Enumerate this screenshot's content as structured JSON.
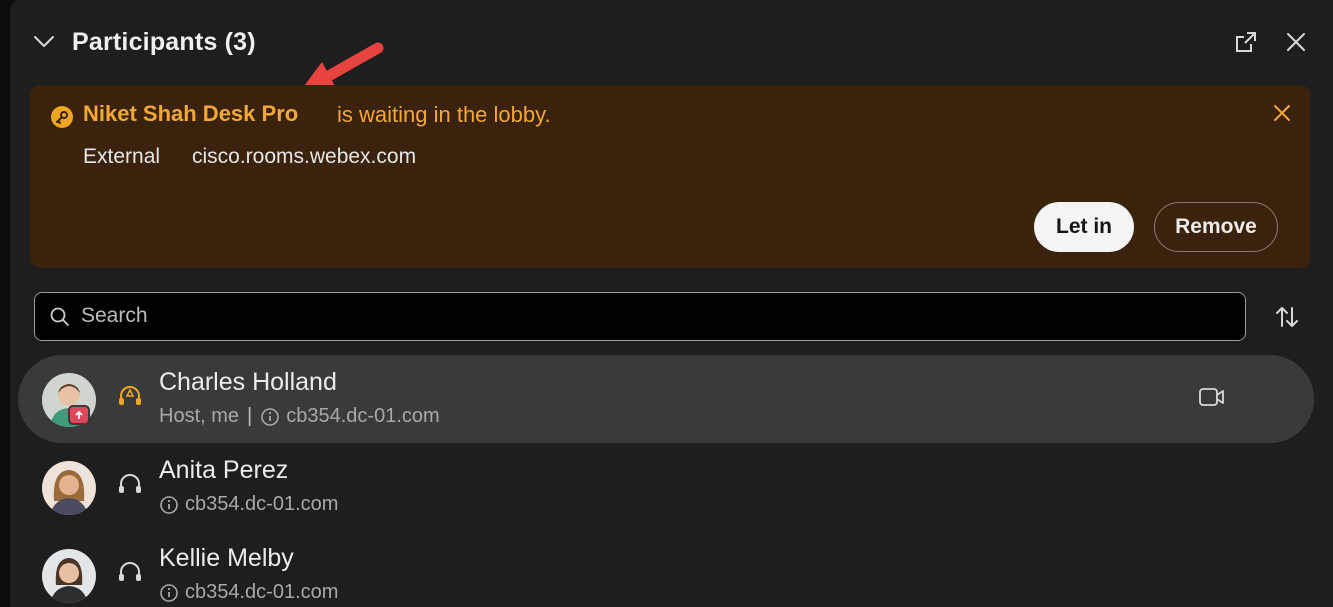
{
  "header": {
    "title": "Participants (3)"
  },
  "lobby": {
    "name": "Niket Shah Desk Pro",
    "message": "is waiting in the lobby.",
    "type": "External",
    "domain": "cisco.rooms.webex.com",
    "let_in_label": "Let in",
    "remove_label": "Remove",
    "accent_color": "#f2a833"
  },
  "search": {
    "placeholder": "Search",
    "value": ""
  },
  "participants": [
    {
      "name": "Charles Holland",
      "role": "Host, me",
      "domain": "cb354.dc-01.com",
      "audio": "headset-active",
      "video": "video-icon"
    },
    {
      "name": "Anita Perez",
      "role": "",
      "domain": "cb354.dc-01.com",
      "audio": "headset"
    },
    {
      "name": "Kellie Melby",
      "role": "",
      "domain": "cb354.dc-01.com",
      "audio": "headset"
    }
  ]
}
